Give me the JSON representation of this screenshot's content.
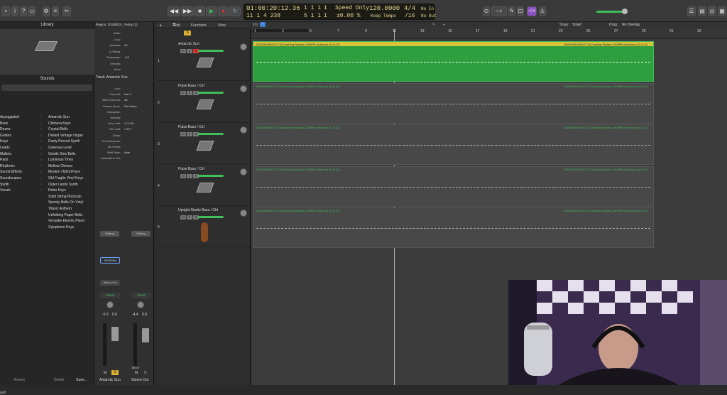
{
  "toolbar": {
    "lcd": {
      "time": "01:00:20:12.36",
      "bars": "11 1 4 238",
      "pos1": "1 1 1",
      "pos2": "5 1 1",
      "pos3": "1",
      "pos4": "1",
      "mode": "Speed Only",
      "percent": "±0.00 %",
      "tempo": "120.0000",
      "tempo_label": "Keep Tempo",
      "sig": "4/4",
      "div": "/16",
      "in": "No In",
      "out": "No Out"
    },
    "cpu_label": "≈04"
  },
  "library": {
    "title": "Library",
    "sounds_title": "Sounds",
    "categories": [
      "Arpeggiated",
      "Bass",
      "Drums",
      "Guitars",
      "Keys",
      "Leads",
      "Mallets",
      "Pads",
      "Rhythmic",
      "Sound Effects",
      "Soundscapes",
      "Synth",
      "Vocals"
    ],
    "sounds": [
      "Antarctic Sun",
      "Chimera Keys",
      "Crystal Bells",
      "Distant Vintage Organ",
      "Dusty Record Synth",
      "Gaseous Lead",
      "Gentle Sine Bells",
      "Luminous Tines",
      "Mellow Chimes",
      "Modern Hybrid Keys",
      "Old Fragile Vinyl Keys",
      "Outer Lands Synth",
      "Retro Keys",
      "Solid String Pizzicato",
      "Spooky Bells On Vinyl",
      "Titanic Anthem",
      "Unfolding Paper Bells",
      "Versatile Electric Piano",
      "Xylophone Keys"
    ],
    "bottom": {
      "revert": "Revert",
      "delete": "Delete",
      "save": "Save..."
    }
  },
  "inspector": {
    "region_label": "Region: 20180[03...rmony (1)",
    "region_rows": [
      [
        "Mute:",
        ""
      ],
      [
        "Loop:",
        ""
      ],
      [
        "Quantize",
        "off"
      ],
      [
        "Q-Swing:",
        ""
      ],
      [
        "Transpose:",
        "+12"
      ],
      [
        "Velocity:",
        ""
      ],
      [
        "More",
        ""
      ]
    ],
    "track_label": "Track: Antarctic Sun",
    "track_rows": [
      [
        "Icon:",
        ""
      ],
      [
        "Channel:",
        "Inst 1"
      ],
      [
        "MIDI Channel:",
        "All"
      ],
      [
        "Freeze Mode:",
        "Pre Fader"
      ],
      [
        "Transpose:",
        ""
      ],
      [
        "Velocity:",
        ""
      ],
      [
        "Key Limit:",
        "C-2 G8"
      ],
      [
        "Vel Limit:",
        "1 127"
      ],
      [
        "Delay:",
        ""
      ],
      [
        "No Transpose:",
        ""
      ],
      [
        "No Reset:",
        ""
      ],
      [
        "Staff Style:",
        "Auto"
      ],
      [
        "Articulation Set:",
        ""
      ]
    ],
    "strip1": {
      "plugin": "Alchemy",
      "out": "Stereo Out",
      "auto": "Read",
      "vol": "-6.0",
      "pan": "0.0",
      "name": "Antarctic Sun"
    },
    "strip2": {
      "auto": "Read",
      "vol": "-4.4",
      "pan": "0.0",
      "name": "Stereo Out",
      "bnce": "Bnce"
    },
    "setting": "Setting"
  },
  "arrange": {
    "menu": {
      "edit": "Edit",
      "functions": "Functions",
      "view": "View",
      "snap_label": "Snap:",
      "snap": "Smart",
      "drag_label": "Drag:",
      "drag": "No Overlap"
    },
    "ruler": [
      "1",
      "3",
      "5",
      "7",
      "9",
      "11",
      "13",
      "15",
      "17",
      "19",
      "21",
      "23",
      "25",
      "27",
      "29",
      "31",
      "33"
    ],
    "region_name": "20180303000107716-Dashing Skylark-1308PM-Harmony (1) (+12)",
    "tracks": [
      {
        "num": "1",
        "name": "Antarctic Sun",
        "sub": ""
      },
      {
        "num": "2",
        "name": "Pulse Bass",
        "sub": "Ctrl"
      },
      {
        "num": "3",
        "name": "Pulse Bass",
        "sub": "Ctrl"
      },
      {
        "num": "4",
        "name": "Pulse Bass",
        "sub": "Ctrl"
      },
      {
        "num": "5",
        "name": "Upright Studio Bass",
        "sub": "Ctrl"
      }
    ]
  },
  "colors": {
    "accent_green": "#2e9e3e",
    "region_yellow": "#d9c33a",
    "lcd_text": "#e8d69a"
  }
}
